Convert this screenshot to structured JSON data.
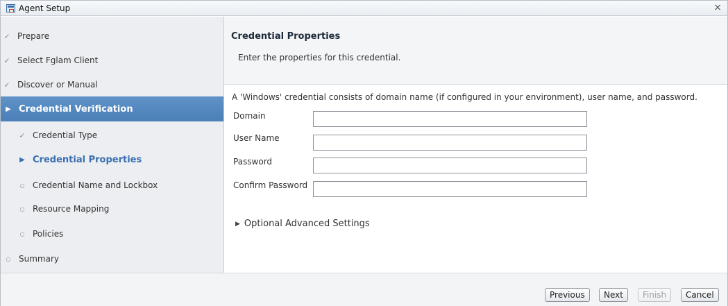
{
  "window": {
    "title": "Agent Setup",
    "close_glyph": "×",
    "icon": "wizard-app-icon"
  },
  "steps": [
    {
      "label": "Prepare",
      "mark": "✓",
      "state": "done"
    },
    {
      "label": "Select Fglam Client",
      "mark": "✓",
      "state": "done"
    },
    {
      "label": "Discover or Manual",
      "mark": "✓",
      "state": "done"
    },
    {
      "label": "Credential Verification",
      "mark": "▶",
      "state": "active"
    },
    {
      "label": "Credential Type",
      "mark": "✓",
      "state": "done"
    },
    {
      "label": "Credential Properties",
      "mark": "▶",
      "state": "current"
    },
    {
      "label": "Credential Name and Lockbox",
      "mark": "○",
      "state": "pending"
    },
    {
      "label": "Resource Mapping",
      "mark": "○",
      "state": "pending"
    },
    {
      "label": "Policies",
      "mark": "○",
      "state": "pending"
    },
    {
      "label": "Summary",
      "mark": "○",
      "state": "pending"
    }
  ],
  "main": {
    "title": "Credential Properties",
    "description": "Enter the properties for this credential.",
    "info": "A 'Windows' credential consists of domain name (if configured in your environment), user name, and password.",
    "fields": [
      {
        "label": "Domain",
        "value": ""
      },
      {
        "label": "User Name",
        "value": ""
      },
      {
        "label": "Password",
        "value": ""
      },
      {
        "label": "Confirm Password",
        "value": ""
      }
    ],
    "advanced": {
      "label": "Optional Advanced Settings",
      "glyph": "▶"
    }
  },
  "footer": {
    "previous": "Previous",
    "next": "Next",
    "finish": "Finish",
    "cancel": "Cancel"
  },
  "colors": {
    "active_step_bg": "#4a7fb7",
    "current_step_text": "#3a6fb0",
    "sidebar_bg": "#eceef1"
  }
}
